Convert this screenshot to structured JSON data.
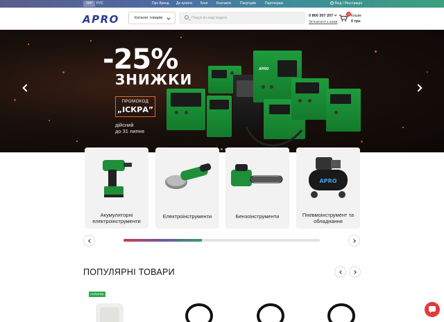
{
  "topbar": {
    "languages": [
      {
        "label": "УКР",
        "active": true
      },
      {
        "label": "РУС",
        "active": false
      }
    ],
    "nav": [
      "Про бренд",
      "Де купити",
      "Блог",
      "Контакти",
      "Покупцям",
      "Партнерам"
    ],
    "login": "Вхід / Реєстрація"
  },
  "header": {
    "logo": "APRO",
    "catalog_label": "Каталог товарів",
    "search_placeholder": "Пошук по коду моделі",
    "phone": "0 800 307 207",
    "callback_label": "Зв'язатися з нами",
    "cart_count": "0",
    "cart_label": "Кошик",
    "cart_total": "0 грн"
  },
  "hero": {
    "discount": "-25%",
    "subtitle": "ЗНИЖКИ",
    "promo_label": "ПРОМОКОД",
    "promo_code": "„ІСКРА”",
    "valid_line1": "дійсний",
    "valid_line2": "до 31 липня",
    "slides_total": 5,
    "active_slide": 1,
    "machine_brand": "APRO"
  },
  "categories": [
    {
      "label": "Акумуляторні електроінструменти",
      "icon": "cordless-drill"
    },
    {
      "label": "Електроінструменти",
      "icon": "angle-grinder"
    },
    {
      "label": "Бензоінструменти",
      "icon": "chainsaw"
    },
    {
      "label": "Пневмоінструмент та обладнання",
      "icon": "air-compressor"
    }
  ],
  "categories_slider_progress": 0.4,
  "popular": {
    "title": "ПОПУЛЯРНІ ТОВАРИ",
    "new_badge": "НОВИНКА"
  },
  "colors": {
    "brand_blue": "#2c3e95",
    "accent_red": "#e23b3b",
    "machine_green": "#1e9c3c",
    "badge_green": "#2fa84f"
  }
}
